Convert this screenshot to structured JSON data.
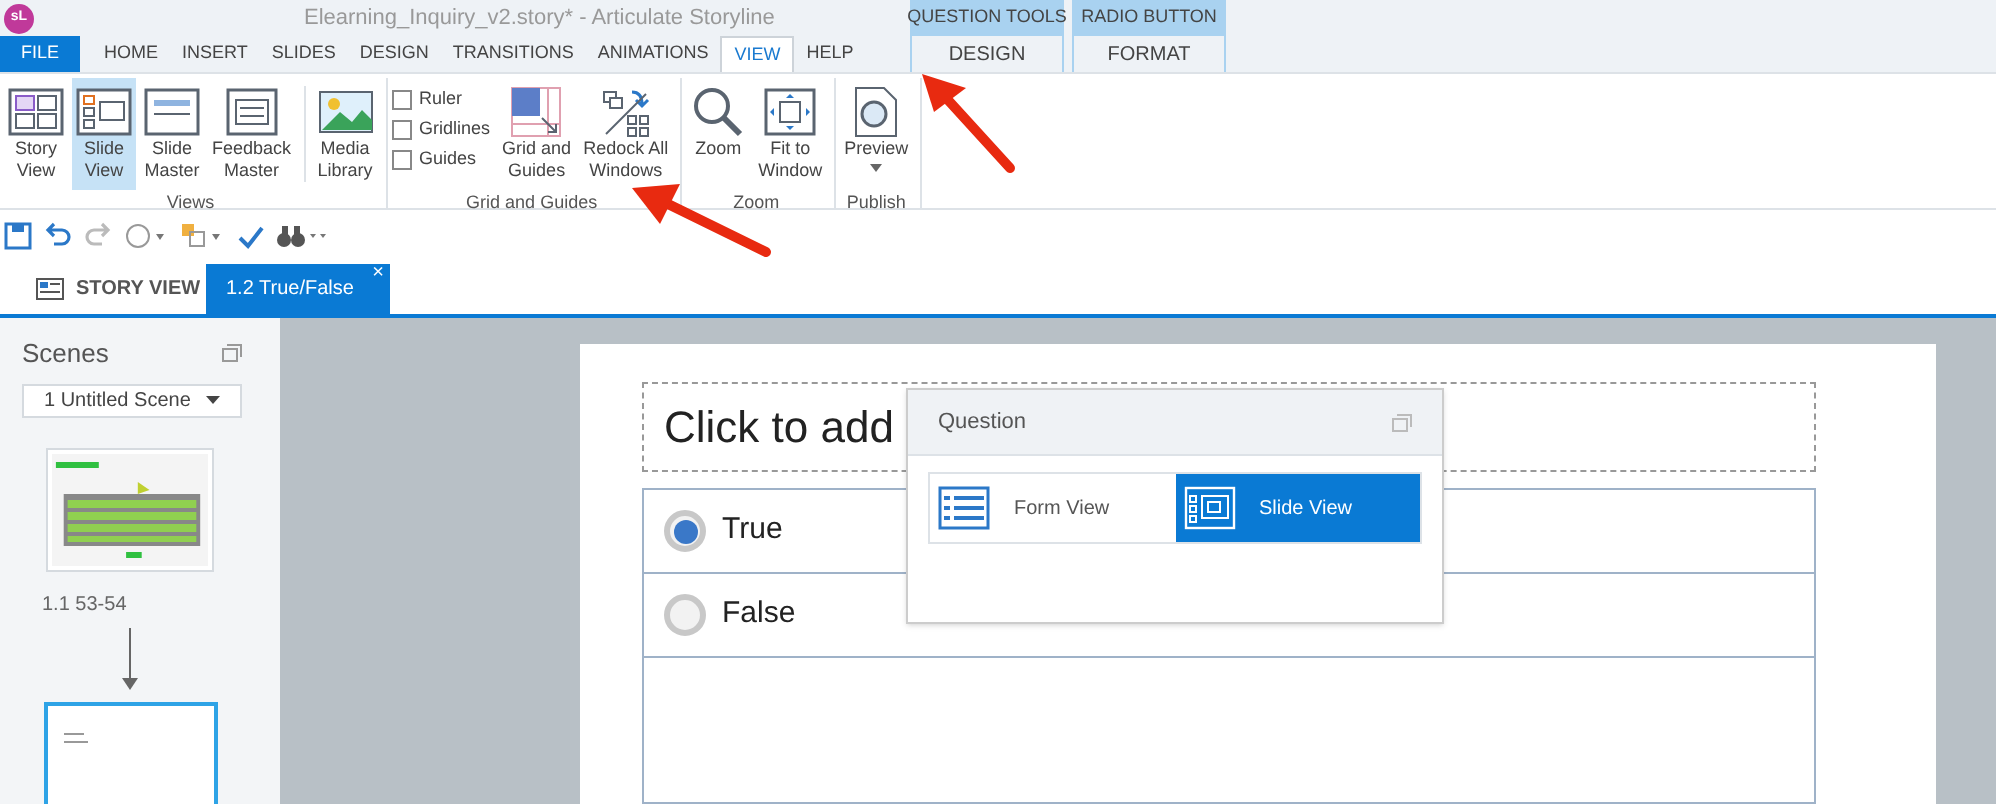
{
  "title_bar": {
    "app_icon": "sL",
    "title": "Elearning_Inquiry_v2.story* -  Articulate Storyline"
  },
  "context_groups": [
    {
      "label": "QUESTION TOOLS",
      "tab": {
        "label": "DESIGN",
        "selected": false
      }
    },
    {
      "label": "RADIO BUTTON",
      "tab": {
        "label": "FORMAT",
        "selected": false
      }
    }
  ],
  "tabs": [
    {
      "label": "FILE",
      "kind": "file",
      "selected": false
    },
    {
      "label": "HOME",
      "kind": "tab",
      "selected": false
    },
    {
      "label": "INSERT",
      "kind": "tab",
      "selected": false
    },
    {
      "label": "SLIDES",
      "kind": "tab",
      "selected": false
    },
    {
      "label": "DESIGN",
      "kind": "tab",
      "selected": false
    },
    {
      "label": "TRANSITIONS",
      "kind": "tab",
      "selected": false
    },
    {
      "label": "ANIMATIONS",
      "kind": "tab",
      "selected": false
    },
    {
      "label": "VIEW",
      "kind": "tab",
      "selected": true
    },
    {
      "label": "HELP",
      "kind": "tab",
      "selected": false
    }
  ],
  "ribbon_groups": [
    {
      "label": "Views",
      "items": [
        {
          "kind": "large",
          "lines": [
            "Story",
            "View"
          ],
          "selected": false
        },
        {
          "kind": "large",
          "lines": [
            "Slide",
            "View"
          ],
          "selected": true
        },
        {
          "kind": "large",
          "lines": [
            "Slide",
            "Master"
          ],
          "selected": false
        },
        {
          "kind": "large",
          "lines": [
            "Feedback",
            "Master"
          ],
          "selected": false
        },
        {
          "kind": "separator"
        },
        {
          "kind": "large",
          "lines": [
            "Media",
            "Library"
          ],
          "selected": false
        }
      ]
    },
    {
      "label": "Grid and Guides",
      "items": [
        {
          "kind": "checks",
          "boxes": [
            {
              "label": "Ruler",
              "checked": false
            },
            {
              "label": "Gridlines",
              "checked": false
            },
            {
              "label": "Guides",
              "checked": false
            }
          ]
        },
        {
          "kind": "large",
          "lines": [
            "Grid and",
            "Guides"
          ],
          "selected": false
        },
        {
          "kind": "large",
          "lines": [
            "Redock All",
            "Windows"
          ],
          "selected": false
        }
      ]
    },
    {
      "label": "Zoom",
      "items": [
        {
          "kind": "large",
          "lines": [
            "Zoom"
          ],
          "selected": false
        },
        {
          "kind": "large",
          "lines": [
            "Fit to",
            "Window"
          ],
          "selected": false
        }
      ]
    },
    {
      "label": "Publish",
      "items": [
        {
          "kind": "large",
          "lines": [
            "Preview"
          ],
          "selected": false,
          "dropdown": true
        }
      ]
    }
  ],
  "doc_tabs": [
    {
      "label": "STORY VIEW",
      "selected": false
    },
    {
      "label": "1.2 True/False",
      "selected": true,
      "close": "×"
    }
  ],
  "scenes_panel": {
    "title": "Scenes",
    "scene_select": "1 Untitled Scene",
    "slides": [
      {
        "kind": "picture",
        "label": "1.1 53-54",
        "selected": false
      },
      {
        "kind": "blank",
        "selected": true
      }
    ]
  },
  "slide": {
    "title_placeholder": "Click to add",
    "choices": [
      {
        "label": "True",
        "selected": true
      },
      {
        "label": "False",
        "selected": false
      }
    ]
  },
  "question_panel": {
    "title": "Question",
    "views": [
      {
        "label": "Form View",
        "selected": false
      },
      {
        "label": "Slide View",
        "selected": true
      }
    ]
  }
}
